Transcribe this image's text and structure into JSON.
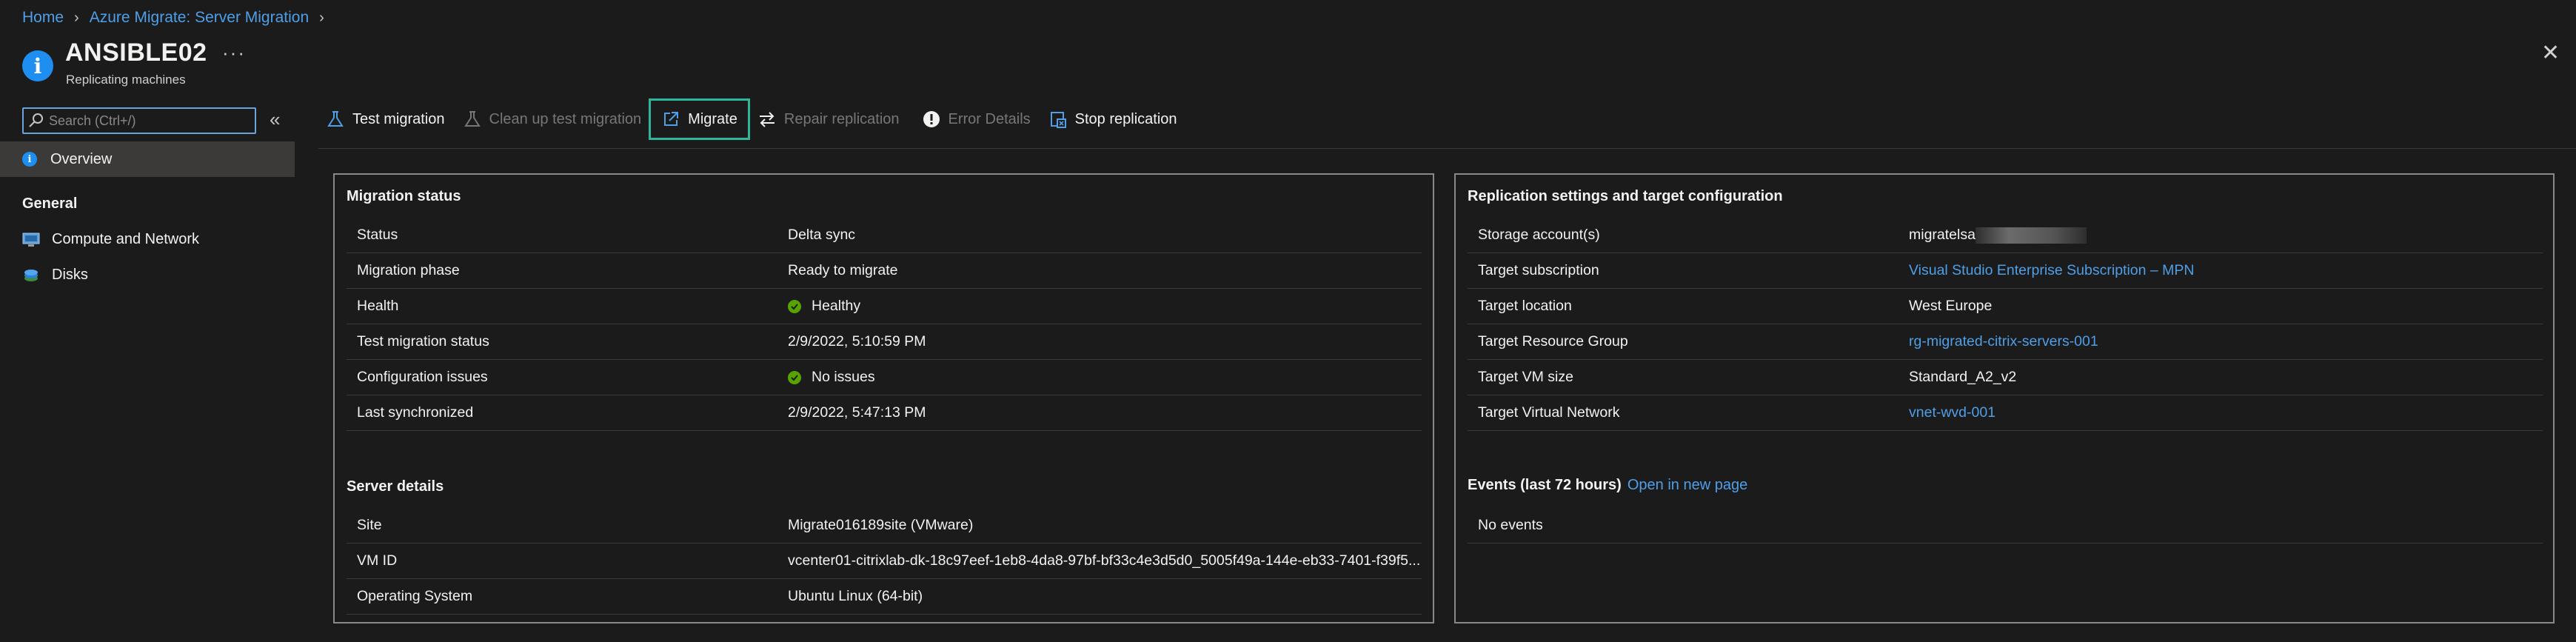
{
  "breadcrumb": {
    "home": "Home",
    "parent": "Azure Migrate: Server Migration",
    "sep": "›"
  },
  "header": {
    "title": "ANSIBLE02",
    "subtitle": "Replicating machines",
    "more": "···",
    "close": "✕",
    "icon": "info-icon"
  },
  "sidebar": {
    "search_placeholder": "Search (Ctrl+/)",
    "collapse": "«",
    "overview": "Overview",
    "general_heading": "General",
    "items": [
      {
        "label": "Compute and Network",
        "icon": "monitor-icon"
      },
      {
        "label": "Disks",
        "icon": "disks-icon"
      }
    ]
  },
  "toolbar": {
    "test_migration": "Test migration",
    "cleanup": "Clean up test migration",
    "migrate": "Migrate",
    "repair": "Repair replication",
    "error_details": "Error Details",
    "stop": "Stop replication"
  },
  "migration_status": {
    "title": "Migration status",
    "rows": [
      {
        "k": "Status",
        "v": "Delta sync"
      },
      {
        "k": "Migration phase",
        "v": "Ready to migrate"
      },
      {
        "k": "Health",
        "v": "Healthy"
      },
      {
        "k": "Test migration status",
        "v": "2/9/2022, 5:10:59 PM"
      },
      {
        "k": "Configuration issues",
        "v": "No issues"
      },
      {
        "k": "Last synchronized",
        "v": "2/9/2022, 5:47:13 PM"
      }
    ]
  },
  "server_details": {
    "title": "Server details",
    "rows": [
      {
        "k": "Site",
        "v": "Migrate016189site (VMware)"
      },
      {
        "k": "VM ID",
        "v": "vcenter01-citrixlab-dk-18c97eef-1eb8-4da8-97bf-bf33c4e3d5d0_5005f49a-144e-eb33-7401-f39f5..."
      },
      {
        "k": "Operating System",
        "v": "Ubuntu Linux (64-bit)"
      }
    ]
  },
  "replication": {
    "title": "Replication settings and target configuration",
    "rows": [
      {
        "k": "Storage account(s)",
        "v": "migratelsa"
      },
      {
        "k": "Target subscription",
        "v": "Visual Studio Enterprise Subscription – MPN"
      },
      {
        "k": "Target location",
        "v": "West Europe"
      },
      {
        "k": "Target Resource Group",
        "v": "rg-migrated-citrix-servers-001"
      },
      {
        "k": "Target VM size",
        "v": "Standard_A2_v2"
      },
      {
        "k": "Target Virtual Network",
        "v": "vnet-wvd-001"
      }
    ]
  },
  "events": {
    "title": "Events (last 72 hours)",
    "link": "Open in new page",
    "empty": "No events"
  },
  "colors": {
    "link": "#4f9fe8",
    "accent": "#1e8ef0",
    "focus": "#2fb59a",
    "ok": "#57a300"
  }
}
